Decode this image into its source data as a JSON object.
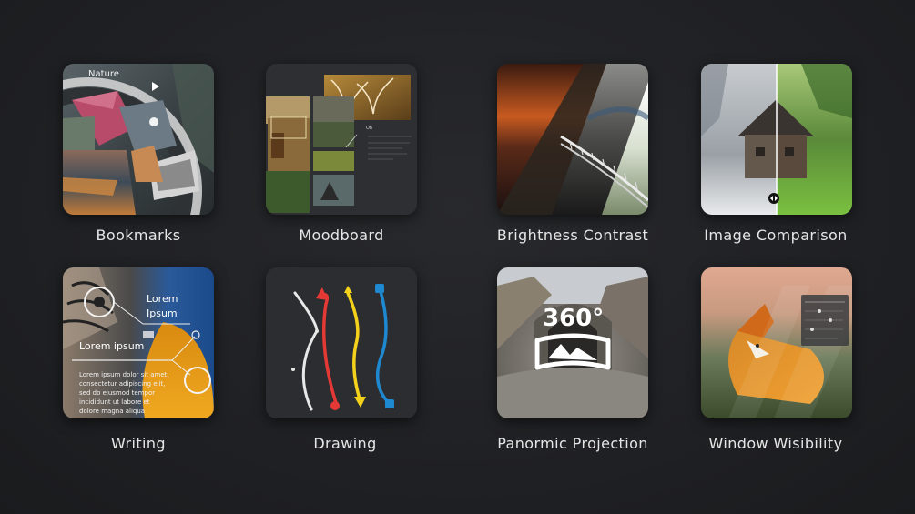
{
  "apps": [
    {
      "label": "Bookmarks",
      "icon": "bookmarks-icon",
      "overlay_text": "Nature"
    },
    {
      "label": "Moodboard",
      "icon": "moodboard-icon"
    },
    {
      "label": "Brightness Contrast",
      "icon": "brightness-contrast-icon"
    },
    {
      "label": "Image Comparison",
      "icon": "image-comparison-icon"
    },
    {
      "label": "Writing",
      "icon": "writing-icon",
      "overlay_text_1": "Lorem",
      "overlay_text_2": "Ipsum",
      "overlay_text_3": "Lorem ipsum",
      "body_lines": [
        "Lorem ipsum dolor sit amet,",
        "consectetur adipiscing elit,",
        "sed do eiusmod tempor",
        "incididunt ut labore et",
        "dolore magna aliqua"
      ]
    },
    {
      "label": "Drawing",
      "icon": "drawing-icon"
    },
    {
      "label": "Panormic Projection",
      "icon": "panoramic-projection-icon",
      "overlay_text": "360°"
    },
    {
      "label": "Window Wisibility",
      "icon": "window-visibility-icon"
    }
  ],
  "colors": {
    "background": "#1e1f22",
    "label": "#e6e6e6",
    "tile_dark": "#2b2c30",
    "draw_red": "#e53935",
    "draw_yellow": "#f4d21c",
    "draw_blue": "#1e88d0"
  }
}
